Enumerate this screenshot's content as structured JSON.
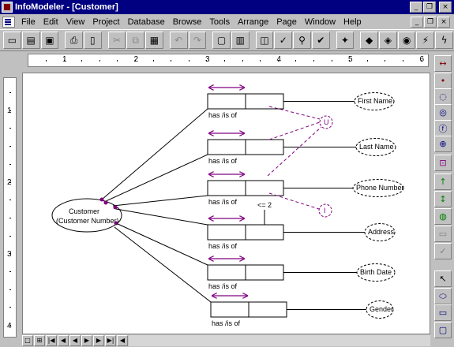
{
  "window": {
    "title": "InfoModeler - [Customer]",
    "caption_buttons": [
      "_",
      "❐",
      "×"
    ]
  },
  "menu": {
    "items": [
      "File",
      "Edit",
      "View",
      "Project",
      "Database",
      "Browse",
      "Tools",
      "Arrange",
      "Page",
      "Window",
      "Help"
    ],
    "doc_buttons": [
      "_",
      "❐",
      "×"
    ]
  },
  "toolbar": {
    "buttons": [
      {
        "name": "new-icon",
        "glyph": "▭",
        "enabled": true
      },
      {
        "name": "open-icon",
        "glyph": "▤",
        "enabled": true
      },
      {
        "name": "save-icon",
        "glyph": "▣",
        "enabled": true
      },
      {
        "sep": true
      },
      {
        "name": "print-icon",
        "glyph": "⎙",
        "enabled": true
      },
      {
        "name": "print-preview-icon",
        "glyph": "▯",
        "enabled": true
      },
      {
        "sep": true
      },
      {
        "name": "cut-icon",
        "glyph": "✂",
        "enabled": false
      },
      {
        "name": "copy-icon",
        "glyph": "⧉",
        "enabled": false
      },
      {
        "name": "paste-icon",
        "glyph": "▦",
        "enabled": true
      },
      {
        "sep": true
      },
      {
        "name": "undo-icon",
        "glyph": "↶",
        "enabled": false
      },
      {
        "name": "redo-icon",
        "glyph": "↷",
        "enabled": false
      },
      {
        "sep": true
      },
      {
        "name": "new-page-icon",
        "glyph": "▢",
        "enabled": true
      },
      {
        "name": "page-icon",
        "glyph": "▥",
        "enabled": true
      },
      {
        "sep": true
      },
      {
        "name": "verbalize-icon",
        "glyph": "◫",
        "enabled": true
      },
      {
        "name": "validate-icon",
        "glyph": "✓",
        "enabled": true
      },
      {
        "name": "find-icon",
        "glyph": "⚲",
        "enabled": true
      },
      {
        "name": "check-icon",
        "glyph": "✔",
        "enabled": true
      },
      {
        "sep": true
      },
      {
        "name": "pin-icon",
        "glyph": "✦",
        "enabled": true
      },
      {
        "sep": true
      },
      {
        "name": "build-db-icon",
        "glyph": "◆",
        "enabled": true
      },
      {
        "name": "link-db-icon",
        "glyph": "◈",
        "enabled": true
      },
      {
        "name": "import-db-icon",
        "glyph": "◉",
        "enabled": true
      },
      {
        "name": "merge-icon",
        "glyph": "⚡",
        "enabled": true
      },
      {
        "name": "lightning-icon",
        "glyph": "ϟ",
        "enabled": true
      }
    ]
  },
  "ruler": {
    "h_numbers": [
      "1",
      "2",
      "3",
      "4",
      "5",
      "6"
    ],
    "v_numbers": [
      "1",
      "2",
      "3",
      "4"
    ]
  },
  "diagram": {
    "entity": {
      "name": "Customer",
      "ref_mode": "(Customer Number)"
    },
    "facts": [
      {
        "value": "First Name",
        "reading": "has /is of"
      },
      {
        "value": "Last Name",
        "reading": "has /is of"
      },
      {
        "value": "Phone Number",
        "reading": "has /is of"
      },
      {
        "value": "Address",
        "reading": "has /is of"
      },
      {
        "value": "Birth Date",
        "reading": "has /is of"
      },
      {
        "value": "Gender",
        "reading": "has /is of"
      }
    ],
    "constraint_u": "U",
    "constraint_i": "I",
    "frequency": "<= 2",
    "colors": {
      "constraint": "#800080",
      "line": "#000000"
    }
  },
  "palette": {
    "buttons": [
      {
        "name": "role-connector-icon",
        "glyph": "↔",
        "color": "#800000"
      },
      {
        "name": "object-type-icon",
        "glyph": "•",
        "color": "#800000"
      },
      {
        "name": "entity-icon",
        "glyph": "◌",
        "color": "#000080"
      },
      {
        "name": "value-icon",
        "glyph": "◎",
        "color": "#000080"
      },
      {
        "name": "fact-icon",
        "glyph": "ⓕ",
        "color": "#000080"
      },
      {
        "name": "nested-fact-icon",
        "glyph": "⊕",
        "color": "#000080"
      },
      {
        "name": "unique-constraint-icon",
        "glyph": "⊡",
        "color": "#800080"
      },
      {
        "name": "arrow-up-icon",
        "glyph": "↑",
        "color": "#008000"
      },
      {
        "name": "arrow-updown-icon",
        "glyph": "↕",
        "color": "#008000"
      },
      {
        "name": "subtype-icon",
        "glyph": "◍",
        "color": "#008000"
      },
      {
        "name": "textbox-icon",
        "glyph": "▭",
        "color": "#808080"
      },
      {
        "name": "checkmark-icon",
        "glyph": "✓",
        "color": "#808080"
      },
      {
        "name": "pointer-icon",
        "glyph": "↖",
        "color": "#000000"
      },
      {
        "name": "ellipse-icon",
        "glyph": "⬭",
        "color": "#000080"
      },
      {
        "name": "rectangle-icon",
        "glyph": "▭",
        "color": "#000080"
      },
      {
        "name": "rounded-rect-icon",
        "glyph": "▢",
        "color": "#000080"
      }
    ]
  },
  "scrollbar": {
    "buttons": [
      "□",
      "⊞",
      "|◀",
      "◀",
      "◀",
      "▶",
      "▶",
      "▶|",
      "◀"
    ]
  }
}
